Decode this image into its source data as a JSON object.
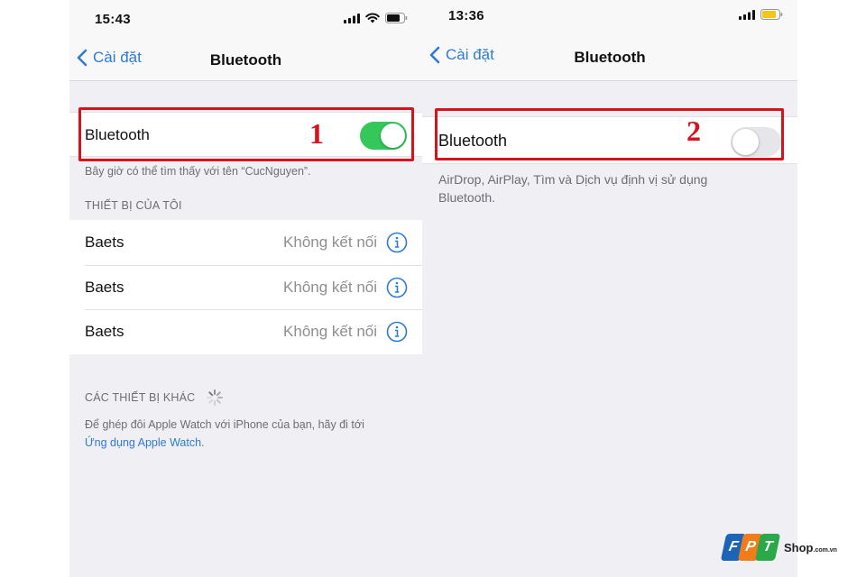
{
  "left_screen": {
    "status_bar": {
      "time": "15:43",
      "icons": [
        "signal-icon",
        "wifi-icon",
        "battery-icon"
      ],
      "battery_color": "#111111"
    },
    "nav": {
      "back_label": "Cài đặt",
      "title": "Bluetooth"
    },
    "bluetooth_toggle": {
      "label": "Bluetooth",
      "state": "on"
    },
    "discoverable_text": "Bây giờ có thể tìm thấy với tên “CucNguyen”.",
    "my_devices": {
      "header": "THIẾT BỊ CỦA TÔI",
      "items": [
        {
          "name": "Baets",
          "status": "Không kết nối"
        },
        {
          "name": "Baets",
          "status": "Không kết nối"
        },
        {
          "name": "Baets",
          "status": "Không kết nối"
        }
      ]
    },
    "other_devices": {
      "header": "CÁC THIẾT BỊ KHÁC",
      "apple_watch_text": "Để ghép đôi Apple Watch với iPhone của bạn, hãy đi tới",
      "apple_watch_link": "Ứng dụng Apple Watch",
      "apple_watch_suffix": "."
    },
    "annotation_number": "1"
  },
  "right_screen": {
    "status_bar": {
      "time": "13:36",
      "icons": [
        "signal-icon",
        "battery-icon"
      ],
      "battery_color": "#f5c518"
    },
    "nav": {
      "back_label": "Cài đặt",
      "title": "Bluetooth"
    },
    "bluetooth_toggle": {
      "label": "Bluetooth",
      "state": "off"
    },
    "off_text": "AirDrop, AirPlay, Tìm và Dịch vụ định vị sử dụng Bluetooth.",
    "annotation_number": "2"
  },
  "colors": {
    "accent": "#2f7bd1",
    "toggle_on": "#34c759",
    "toggle_off": "#e6e6ea",
    "annotation": "#d7121c",
    "background": "#efeff4"
  },
  "watermark": {
    "letters": [
      "F",
      "P",
      "T"
    ],
    "letter_colors": [
      "#1d63b8",
      "#f07c1a",
      "#2aa84a"
    ],
    "brand": "Shop",
    "domain": ".com.vn"
  }
}
